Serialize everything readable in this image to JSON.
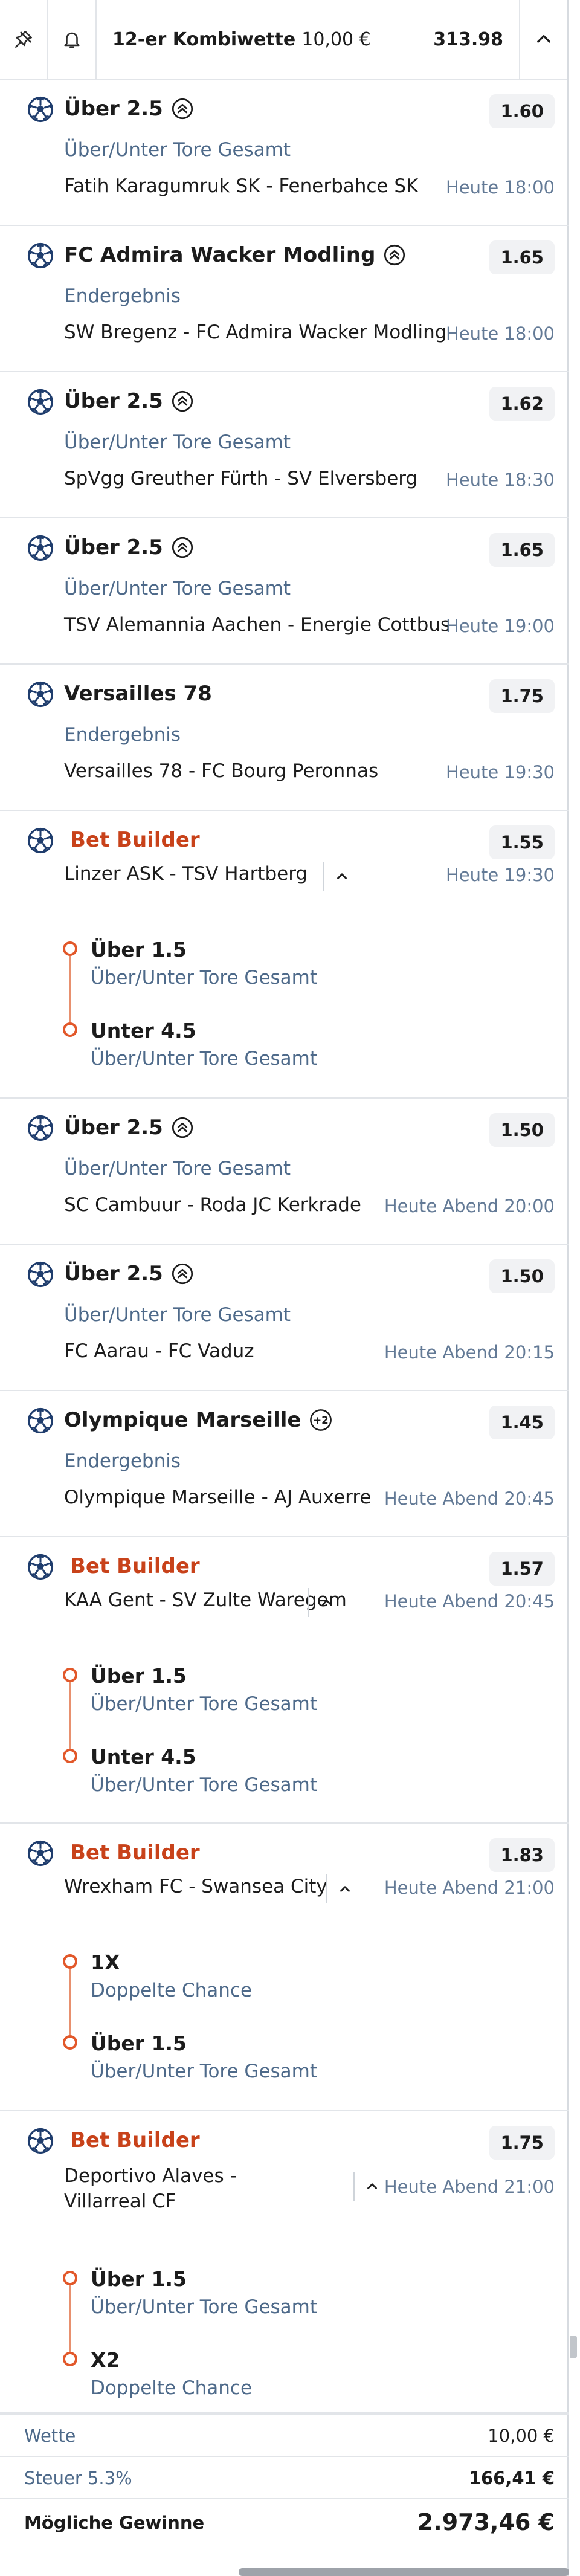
{
  "header": {
    "title": "12-er Kombiwette",
    "stake": "10,00 €",
    "total_odds": "313.98"
  },
  "bets": [
    {
      "selection": "Über 2.5",
      "market": "Über/Unter Tore Gesamt",
      "match": "Fatih Karagumruk SK - Fenerbahce SK",
      "time": "Heute 18:00",
      "odds": "1.60"
    },
    {
      "selection": "FC Admira Wacker Modling",
      "market": "Endergebnis",
      "match": "SW Bregenz - FC Admira Wacker Modling",
      "time": "Heute 18:00",
      "odds": "1.65"
    },
    {
      "selection": "Über 2.5",
      "market": "Über/Unter Tore Gesamt",
      "match": "SpVgg Greuther Fürth - SV Elversberg",
      "time": "Heute 18:30",
      "odds": "1.62"
    },
    {
      "selection": "Über 2.5",
      "market": "Über/Unter Tore Gesamt",
      "match": "TSV Alemannia Aachen - Energie Cottbus",
      "time": "Heute 19:00",
      "odds": "1.65"
    },
    {
      "selection": "Versailles 78",
      "market": "Endergebnis",
      "match": "Versailles 78 - FC Bourg Peronnas",
      "time": "Heute 19:30",
      "odds": "1.75"
    },
    {
      "selection": "Bet Builder",
      "match": "Linzer ASK - TSV Hartberg",
      "time": "Heute 19:30",
      "odds": "1.55",
      "legs": [
        {
          "selection": "Über 1.5",
          "market": "Über/Unter Tore Gesamt"
        },
        {
          "selection": "Unter 4.5",
          "market": "Über/Unter Tore Gesamt"
        }
      ]
    },
    {
      "selection": "Über 2.5",
      "market": "Über/Unter Tore Gesamt",
      "match": "SC Cambuur - Roda JC Kerkrade",
      "time": "Heute Abend 20:00",
      "odds": "1.50"
    },
    {
      "selection": "Über 2.5",
      "market": "Über/Unter Tore Gesamt",
      "match": "FC Aarau - FC Vaduz",
      "time": "Heute Abend 20:15",
      "odds": "1.50"
    },
    {
      "selection": "Olympique Marseille",
      "badge": "+2",
      "market": "Endergebnis",
      "match": "Olympique Marseille - AJ Auxerre",
      "time": "Heute Abend 20:45",
      "odds": "1.45"
    },
    {
      "selection": "Bet Builder",
      "match": "KAA Gent - SV Zulte Waregem",
      "time": "Heute Abend 20:45",
      "odds": "1.57",
      "legs": [
        {
          "selection": "Über 1.5",
          "market": "Über/Unter Tore Gesamt"
        },
        {
          "selection": "Unter 4.5",
          "market": "Über/Unter Tore Gesamt"
        }
      ]
    },
    {
      "selection": "Bet Builder",
      "match": "Wrexham FC - Swansea City",
      "time": "Heute Abend 21:00",
      "odds": "1.83",
      "legs": [
        {
          "selection": "1X",
          "market": "Doppelte Chance"
        },
        {
          "selection": "Über 1.5",
          "market": "Über/Unter Tore Gesamt"
        }
      ]
    },
    {
      "selection": "Bet Builder",
      "match": "Deportivo Alaves - Villarreal CF",
      "time": "Heute Abend 21:00",
      "odds": "1.75",
      "legs": [
        {
          "selection": "Über 1.5",
          "market": "Über/Unter Tore Gesamt"
        },
        {
          "selection": "X2",
          "market": "Doppelte Chance"
        }
      ]
    }
  ],
  "footer": {
    "wette_label": "Wette",
    "wette_value": "10,00 €",
    "steuer_label": "Steuer 5.3%",
    "steuer_value": "166,41 €",
    "gewinn_label": "Mögliche Gewinne",
    "gewinn_value": "2.973,46 €"
  },
  "icons": {
    "header_left": "pin-icon",
    "header_bell": "bell-icon",
    "header_right": "chevron-up-icon",
    "sport": "soccer-ball-icon",
    "boost": "boost-badge-icon",
    "accent": "#c8421a"
  }
}
